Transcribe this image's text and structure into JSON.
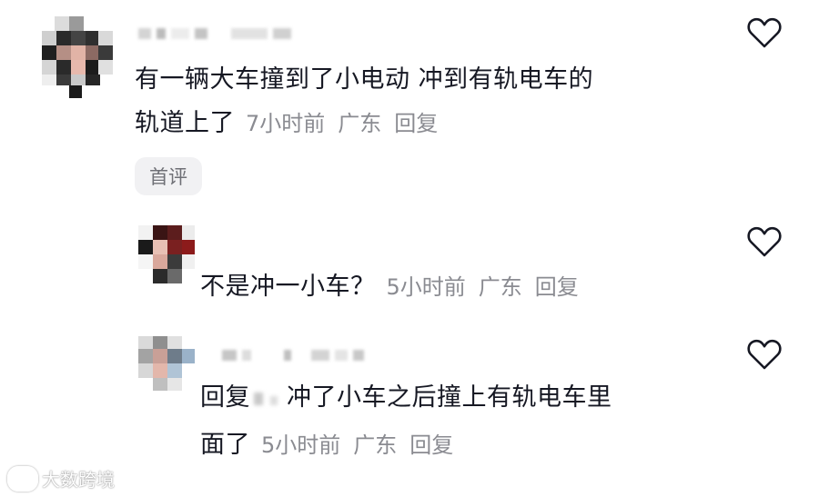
{
  "comments": [
    {
      "text_line1": "有一辆大车撞到了小电动 冲到有轨电车的",
      "text_line2": "轨道上了",
      "time": "7小时前",
      "location": "广东",
      "reply_label": "回复",
      "badge": "首评"
    },
    {
      "text": "不是冲一小车？",
      "time": "5小时前",
      "location": "广东",
      "reply_label": "回复"
    },
    {
      "text_prefix": "回复",
      "text_rest": "冲了小车之后撞上有轨电车里",
      "text_line2": "面了",
      "time": "5小时前",
      "location": "广东",
      "reply_label": "回复"
    }
  ],
  "watermark": {
    "text": "大数跨境"
  },
  "icons": {
    "like": "heart-outline-icon",
    "watermark_logo": "brand-logo-icon"
  },
  "colors": {
    "text": "#161823",
    "meta": "#8a8b91",
    "badge_bg": "#f1f1f3"
  }
}
